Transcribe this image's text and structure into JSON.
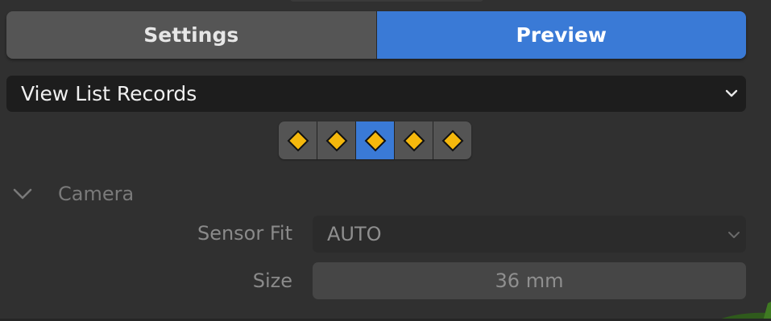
{
  "tabs": [
    {
      "label": "Settings",
      "active": false
    },
    {
      "label": "Preview",
      "active": true
    }
  ],
  "view_select": {
    "value": "View List Records"
  },
  "keyframes": {
    "count": 5,
    "active_index": 2,
    "icon": "keyframe-diamond-icon",
    "icon_color": "#f5b80c"
  },
  "camera_panel": {
    "title": "Camera",
    "expanded": true,
    "sensor_fit": {
      "label": "Sensor Fit",
      "value": "AUTO"
    },
    "size": {
      "label": "Size",
      "value": "36 mm"
    }
  },
  "colors": {
    "accent": "#3a7ad6",
    "background": "#303030",
    "keyframe": "#f5b80c"
  }
}
